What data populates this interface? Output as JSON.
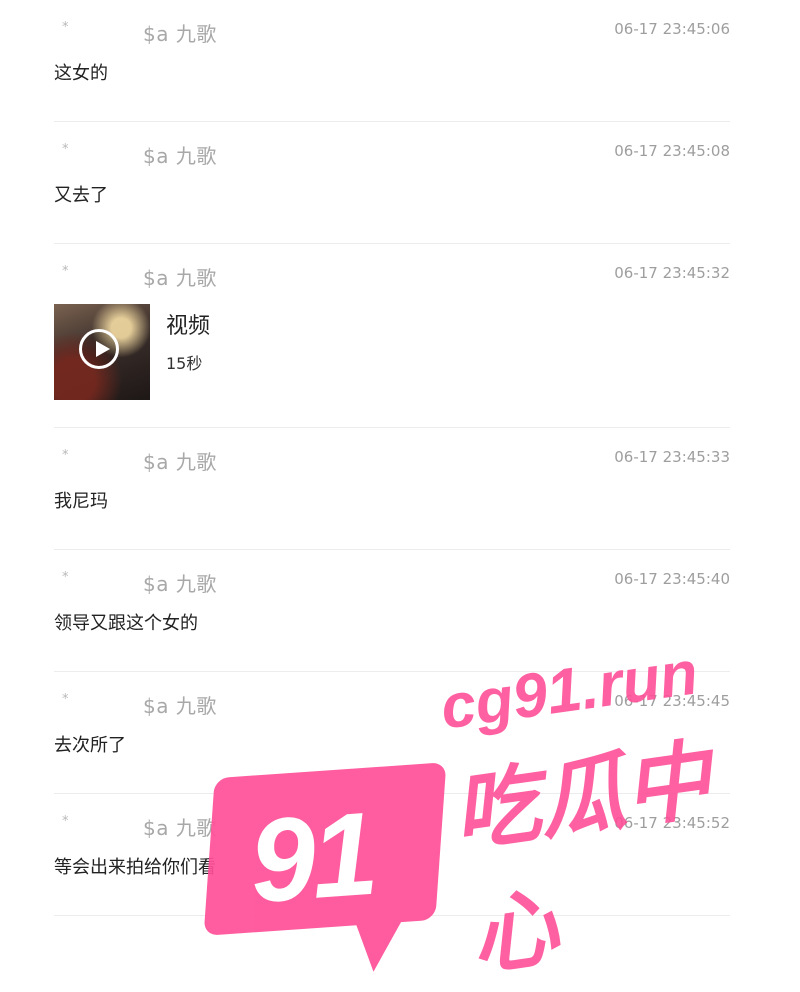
{
  "messages": [
    {
      "star": "*",
      "sender": "$a 九歌",
      "time": "06-17 23:45:06",
      "text": "这女的"
    },
    {
      "star": "*",
      "sender": "$a 九歌",
      "time": "06-17 23:45:08",
      "text": "又去了"
    },
    {
      "star": "*",
      "sender": "$a 九歌",
      "time": "06-17 23:45:32",
      "video_title": "视频",
      "video_duration": "15秒"
    },
    {
      "star": "*",
      "sender": "$a 九歌",
      "time": "06-17 23:45:33",
      "text": "我尼玛"
    },
    {
      "star": "*",
      "sender": "$a 九歌",
      "time": "06-17 23:45:40",
      "text": "领导又跟这个女的"
    },
    {
      "star": "*",
      "sender": "$a 九歌",
      "time": "06-17 23:45:45",
      "text": "去次所了"
    },
    {
      "star": "*",
      "sender": "$a 九歌",
      "time": "06-17 23:45:52",
      "text": "等会出来拍给你们看"
    }
  ],
  "watermark": {
    "number": "91",
    "domain": "cg91.run",
    "brand": "吃瓜中心",
    "color": "#ff4f97"
  }
}
